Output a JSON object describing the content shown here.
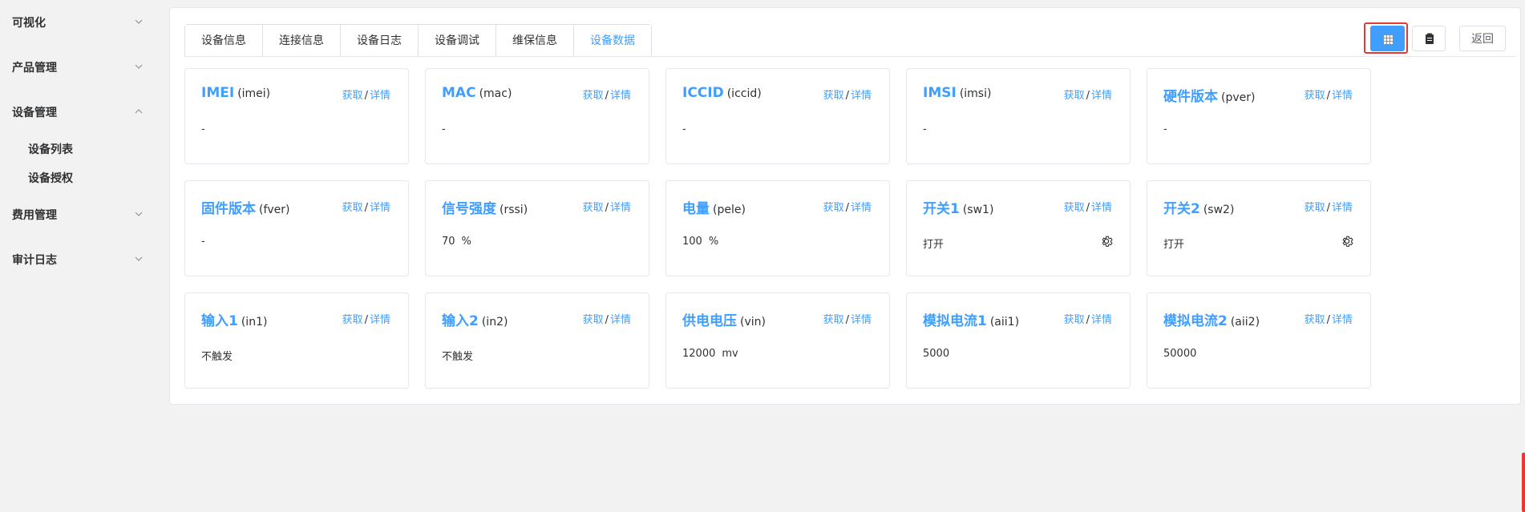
{
  "sidebar": {
    "items": [
      {
        "label": "可视化",
        "expanded": false
      },
      {
        "label": "产品管理",
        "expanded": false
      },
      {
        "label": "设备管理",
        "expanded": true
      },
      {
        "label": "费用管理",
        "expanded": false
      },
      {
        "label": "审计日志",
        "expanded": false
      }
    ],
    "sub_items": [
      {
        "label": "设备列表"
      },
      {
        "label": "设备授权"
      }
    ]
  },
  "tabs": [
    {
      "label": "设备信息",
      "active": false
    },
    {
      "label": "连接信息",
      "active": false
    },
    {
      "label": "设备日志",
      "active": false
    },
    {
      "label": "设备调试",
      "active": false
    },
    {
      "label": "维保信息",
      "active": false
    },
    {
      "label": "设备数据",
      "active": true
    }
  ],
  "toolbar": {
    "grid_view_icon": "grid-icon",
    "list_view_icon": "clipboard-icon",
    "back_label": "返回"
  },
  "common": {
    "fetch_label": "获取",
    "separator": "/",
    "detail_label": "详情"
  },
  "cards": [
    {
      "name": "IMEI",
      "code": "(imei)",
      "value": "-",
      "unit": ""
    },
    {
      "name": "MAC",
      "code": "(mac)",
      "value": "-",
      "unit": ""
    },
    {
      "name": "ICCID",
      "code": "(iccid)",
      "value": "-",
      "unit": ""
    },
    {
      "name": "IMSI",
      "code": "(imsi)",
      "value": "-",
      "unit": ""
    },
    {
      "name": "硬件版本",
      "code": "(pver)",
      "value": "-",
      "unit": ""
    },
    {
      "name": "固件版本",
      "code": "(fver)",
      "value": "-",
      "unit": ""
    },
    {
      "name": "信号强度",
      "code": "(rssi)",
      "value": "70",
      "unit": "%"
    },
    {
      "name": "电量",
      "code": "(pele)",
      "value": "100",
      "unit": "%"
    },
    {
      "name": "开关1",
      "code": "(sw1)",
      "value": "打开",
      "unit": "",
      "gear": true
    },
    {
      "name": "开关2",
      "code": "(sw2)",
      "value": "打开",
      "unit": "",
      "gear": true
    },
    {
      "name": "输入1",
      "code": "(in1)",
      "value": "不触发",
      "unit": ""
    },
    {
      "name": "输入2",
      "code": "(in2)",
      "value": "不触发",
      "unit": ""
    },
    {
      "name": "供电电压",
      "code": "(vin)",
      "value": "12000",
      "unit": "mv"
    },
    {
      "name": "模拟电流1",
      "code": "(aii1)",
      "value": "5000",
      "unit": ""
    },
    {
      "name": "模拟电流2",
      "code": "(aii2)",
      "value": "50000",
      "unit": ""
    }
  ],
  "colors": {
    "accent": "#409eff",
    "highlight": "#e53935"
  }
}
